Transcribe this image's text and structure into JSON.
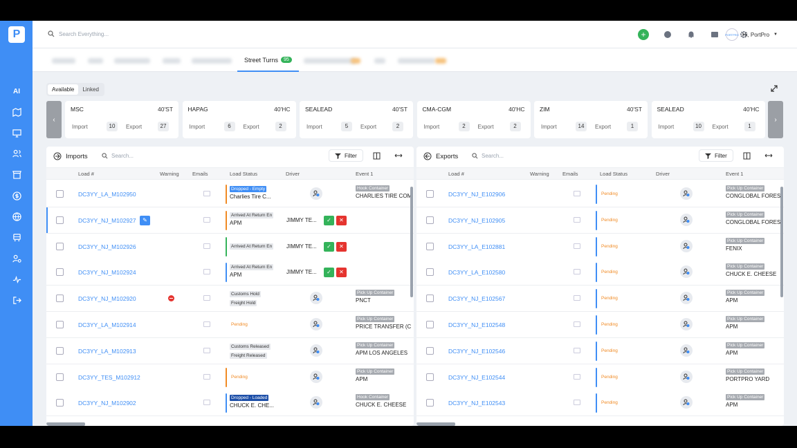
{
  "search": {
    "placeholder": "Search Everything..."
  },
  "user": {
    "greeting": "Hi, PortPro",
    "avatar_text": "PORTPRO"
  },
  "logo": "P",
  "sidebar": {
    "ai_label": "AI"
  },
  "tabs": {
    "active_label": "Street Turns",
    "active_count": "95"
  },
  "toggle": {
    "available": "Available",
    "linked": "Linked"
  },
  "carriers": [
    {
      "name": "MSC",
      "type": "40'ST",
      "import_label": "Import",
      "import": "10",
      "export_label": "Export",
      "export": "27"
    },
    {
      "name": "HAPAG",
      "type": "40'HC",
      "import_label": "Import",
      "import": "6",
      "export_label": "Export",
      "export": "2"
    },
    {
      "name": "SEALEAD",
      "type": "40'ST",
      "import_label": "Import",
      "import": "5",
      "export_label": "Export",
      "export": "2"
    },
    {
      "name": "CMA-CGM",
      "type": "40'HC",
      "import_label": "Import",
      "import": "2",
      "export_label": "Export",
      "export": "2"
    },
    {
      "name": "ZIM",
      "type": "40'ST",
      "import_label": "Import",
      "import": "14",
      "export_label": "Export",
      "export": "1"
    },
    {
      "name": "SEALEAD",
      "type": "40'HC",
      "import_label": "Import",
      "import": "10",
      "export_label": "Export",
      "export": "1"
    }
  ],
  "imports": {
    "title": "Imports",
    "search_placeholder": "Search...",
    "filter": "Filter",
    "columns": {
      "load": "Load #",
      "warning": "Warning",
      "emails": "Emails",
      "status": "Load Status",
      "driver": "Driver",
      "event": "Event 1"
    },
    "rows": [
      {
        "load": "DC3YY_LA_M102950",
        "status_tag": "Dropped - Empty",
        "status_sub": "Charlies Tire C...",
        "event_tag": "Hook Container",
        "event_loc": "CHARLIES TIRE COM"
      },
      {
        "load": "DC3YY_NJ_M102927",
        "status_tag": "Arrived At Return En",
        "status_sub": "APM",
        "driver": "JIMMY TE...",
        "ok": "✓",
        "no": "✕"
      },
      {
        "load": "DC3YY_NJ_M102926",
        "status_tag": "Arrived At Return En",
        "driver": "JIMMY TE...",
        "ok": "✓",
        "no": "✕"
      },
      {
        "load": "DC3YY_NJ_M102924",
        "status_tag": "Arrived At Return En",
        "status_sub": "APM",
        "driver": "JIMMY TE...",
        "ok": "✓",
        "no": "✕"
      },
      {
        "load": "DC3YY_NJ_M102920",
        "status_tag": "Customs Hold",
        "status_tag2": "Freight Hold",
        "event_tag": "Pick Up Container",
        "event_loc": "PNCT"
      },
      {
        "load": "DC3YY_LA_M102914",
        "status_tag": "Pending",
        "event_tag": "Pick Up Container",
        "event_loc": "PRICE TRANSFER (C"
      },
      {
        "load": "DC3YY_LA_M102913",
        "status_tag": "Customs Released",
        "status_tag2": "Freight Released",
        "event_tag": "Pick Up Container",
        "event_loc": "APM LOS ANGELES"
      },
      {
        "load": "DC3YY_TES_M102912",
        "status_tag": "Pending",
        "event_tag": "Pick Up Container",
        "event_loc": "APM"
      },
      {
        "load": "DC3YY_NJ_M102902",
        "status_tag": "Dropped - Loaded",
        "status_sub": "CHUCK E. CHE...",
        "event_tag": "Hook Container",
        "event_loc": "CHUCK E. CHEESE"
      }
    ]
  },
  "exports": {
    "title": "Exports",
    "search_placeholder": "Search...",
    "filter": "Filter",
    "columns": {
      "load": "Load #",
      "warning": "Warning",
      "emails": "Emails",
      "status": "Load Status",
      "driver": "Driver",
      "event": "Event 1"
    },
    "rows": [
      {
        "load": "DC3YY_NJ_E102906",
        "status": "Pending",
        "event_tag": "Pick Up Container",
        "event_loc": "CONGLOBAL FORES"
      },
      {
        "load": "DC3YY_NJ_E102905",
        "status": "Pending",
        "event_tag": "Pick Up Container",
        "event_loc": "CONGLOBAL FORES"
      },
      {
        "load": "DC3YY_LA_E102881",
        "status": "Pending",
        "event_tag": "Pick Up Container",
        "event_loc": "FENIX"
      },
      {
        "load": "DC3YY_LA_E102580",
        "status": "Pending",
        "event_tag": "Pick Up Container",
        "event_loc": "CHUCK E. CHEESE"
      },
      {
        "load": "DC3YY_NJ_E102567",
        "status": "Pending",
        "event_tag": "Pick Up Container",
        "event_loc": "APM"
      },
      {
        "load": "DC3YY_NJ_E102548",
        "status": "Pending",
        "event_tag": "Pick Up Container",
        "event_loc": "APM"
      },
      {
        "load": "DC3YY_NJ_E102546",
        "status": "Pending",
        "event_tag": "Pick Up Container",
        "event_loc": "APM"
      },
      {
        "load": "DC3YY_NJ_E102544",
        "status": "Pending",
        "event_tag": "Pick Up Container",
        "event_loc": "PORTPRO YARD"
      },
      {
        "load": "DC3YY_NJ_E102543",
        "status": "Pending",
        "event_tag": "Pick Up Container",
        "event_loc": "APM"
      }
    ]
  },
  "colors": {
    "accent": "#3f8ef5",
    "success": "#34b35a",
    "danger": "#e5342f",
    "pending": "#f08a24"
  }
}
